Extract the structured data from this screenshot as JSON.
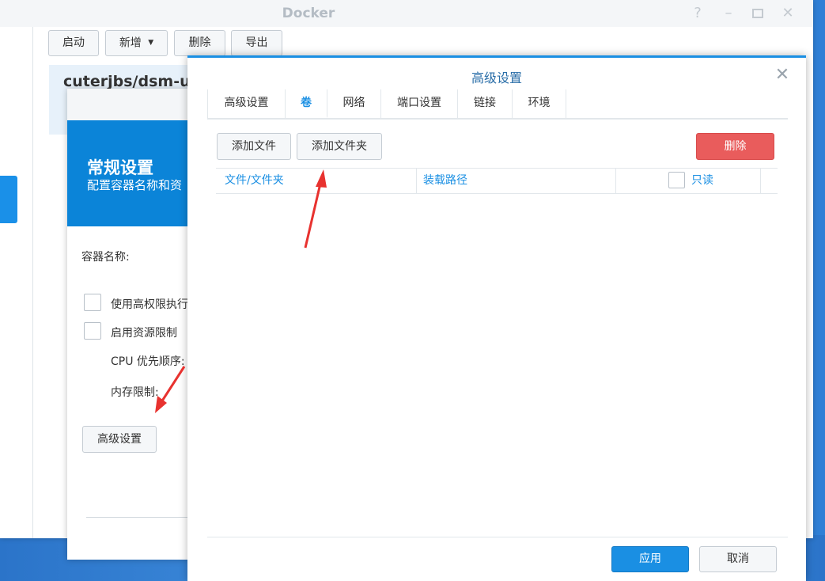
{
  "docker_window": {
    "title": "Docker",
    "toolbar": {
      "start_label": "启动",
      "add_label": "新增",
      "delete_label": "删除",
      "export_label": "导出"
    },
    "container_name": "cuterjbs/dsm-u"
  },
  "general_dialog": {
    "banner_title": "常规设置",
    "banner_subtitle": "配置容器名称和资",
    "container_name_label": "容器名称:",
    "privileged_label": "使用高权限执行",
    "resource_limit_label": "启用资源限制",
    "cpu_priority_label": "CPU 优先顺序:",
    "memory_limit_label": "内存限制:",
    "advanced_button": "高级设置"
  },
  "advanced_dialog": {
    "title": "高级设置",
    "tabs": [
      {
        "label": "高级设置"
      },
      {
        "label": "卷"
      },
      {
        "label": "网络"
      },
      {
        "label": "端口设置"
      },
      {
        "label": "链接"
      },
      {
        "label": "环境"
      }
    ],
    "active_tab": "卷",
    "volume": {
      "add_file_label": "添加文件",
      "add_folder_label": "添加文件夹",
      "delete_label": "删除",
      "columns": [
        "文件/文件夹",
        "装载路径",
        "只读"
      ],
      "rows": []
    },
    "apply_label": "应用",
    "cancel_label": "取消"
  },
  "colors": {
    "accent": "#1a8fe3",
    "danger": "#e95c5c",
    "banner": "#0b84d8",
    "annotation_arrow": "#e8322f"
  },
  "icons": {
    "help": "help-icon",
    "minimize": "minimize-icon",
    "maximize": "maximize-icon",
    "close": "close-icon",
    "dropdown": "caret-down-icon"
  }
}
